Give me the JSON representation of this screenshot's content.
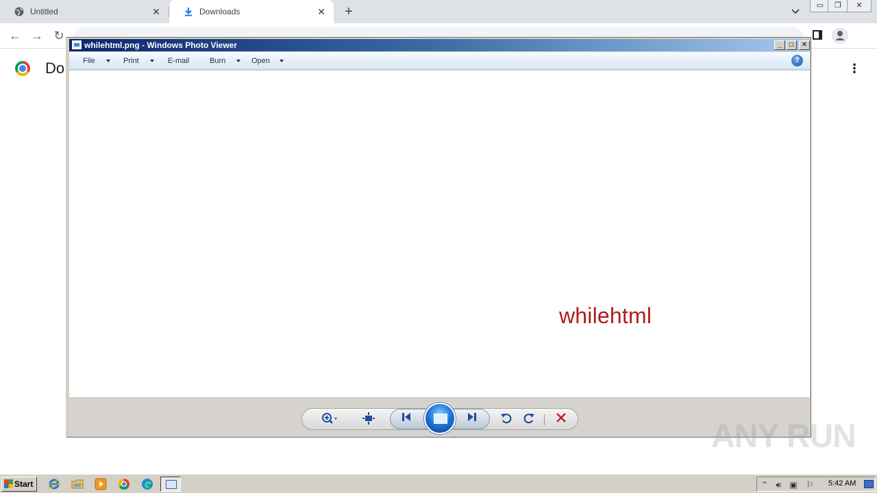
{
  "browser": {
    "tabs": [
      {
        "label": "Untitled",
        "icon": "globe-icon"
      },
      {
        "label": "Downloads",
        "icon": "download-icon"
      }
    ],
    "new_tab_symbol": "+",
    "page": {
      "heading": "Do"
    }
  },
  "photo_viewer": {
    "title": "whilehtml.png - Windows Photo Viewer",
    "menu": [
      {
        "label": "File",
        "has_dropdown": true
      },
      {
        "label": "Print",
        "has_dropdown": true
      },
      {
        "label": "E-mail",
        "has_dropdown": false
      },
      {
        "label": "Burn",
        "has_dropdown": true
      },
      {
        "label": "Open",
        "has_dropdown": true
      }
    ],
    "help_symbol": "?",
    "image_text": "whilehtml",
    "image_text_color": "#b01c1c",
    "controls": [
      "zoom-icon",
      "fit-window-icon",
      "previous-icon",
      "slideshow-icon",
      "next-icon",
      "rotate-ccw-icon",
      "rotate-cw-icon",
      "delete-icon"
    ]
  },
  "watermark": "ANY RUN",
  "taskbar": {
    "start_label": "Start",
    "clock": "5:42 AM",
    "quick_launch": [
      "ie-icon",
      "explorer-icon",
      "media-player-icon",
      "chrome-icon",
      "edge-icon"
    ]
  }
}
